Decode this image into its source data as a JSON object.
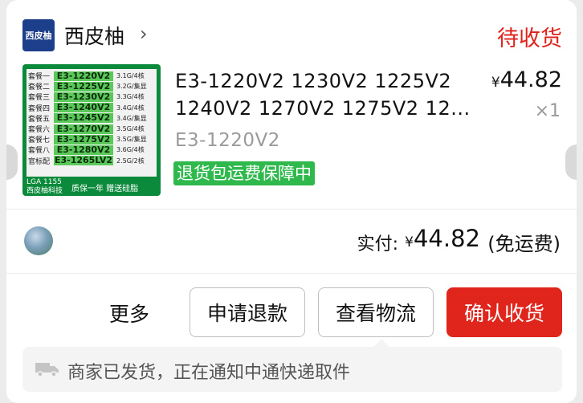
{
  "shop": {
    "logo_text": "西皮柚",
    "name": "西皮柚",
    "arrow": "›",
    "status": "待收货"
  },
  "product": {
    "title_line1": "E3-1220V2 1230V2 1225V2",
    "title_line2": "1240V2 1270V2 1275V2 12...",
    "sku": "E3-1220V2",
    "guarantee": "退货包运费保障中",
    "price_symbol": "¥",
    "price": "44.82",
    "quantity": "×1",
    "thumbnail": {
      "rows": [
        {
          "pkg": "套餐一",
          "model": "E3-1220V2",
          "spec": "3.1G/4核"
        },
        {
          "pkg": "套餐二",
          "model": "E3-1225V2",
          "spec": "3.2G/集显"
        },
        {
          "pkg": "套餐三",
          "model": "E3-1230V2",
          "spec": "3.3G/4核"
        },
        {
          "pkg": "套餐四",
          "model": "E3-1240V2",
          "spec": "3.4G/4核"
        },
        {
          "pkg": "套餐五",
          "model": "E3-1245V2",
          "spec": "3.4G/集显"
        },
        {
          "pkg": "套餐六",
          "model": "E3-1270V2",
          "spec": "3.5G/4核"
        },
        {
          "pkg": "套餐七",
          "model": "E3-1275V2",
          "spec": "3.5G/集显"
        },
        {
          "pkg": "套餐八",
          "model": "E3-1280V2",
          "spec": "3.6G/4核"
        },
        {
          "pkg": "官标配",
          "model": "E3-1265LV2",
          "spec": "2.5G/2核"
        }
      ],
      "socket": "LGA 1155",
      "brand": "西皮柚科技",
      "warranty": "质保一年 赠送硅脂"
    }
  },
  "payment": {
    "label": "实付:",
    "symbol": "¥",
    "amount": "44.82",
    "shipping": "(免运费)"
  },
  "actions": {
    "more": "更多",
    "refund": "申请退款",
    "logistics": "查看物流",
    "confirm": "确认收货"
  },
  "notice": {
    "text": "商家已发货，正在通知中通快递取件"
  },
  "colors": {
    "accent_red": "#e0261c",
    "guarantee_green": "#2fb94d",
    "shop_logo_blue": "#1d3e8a"
  }
}
